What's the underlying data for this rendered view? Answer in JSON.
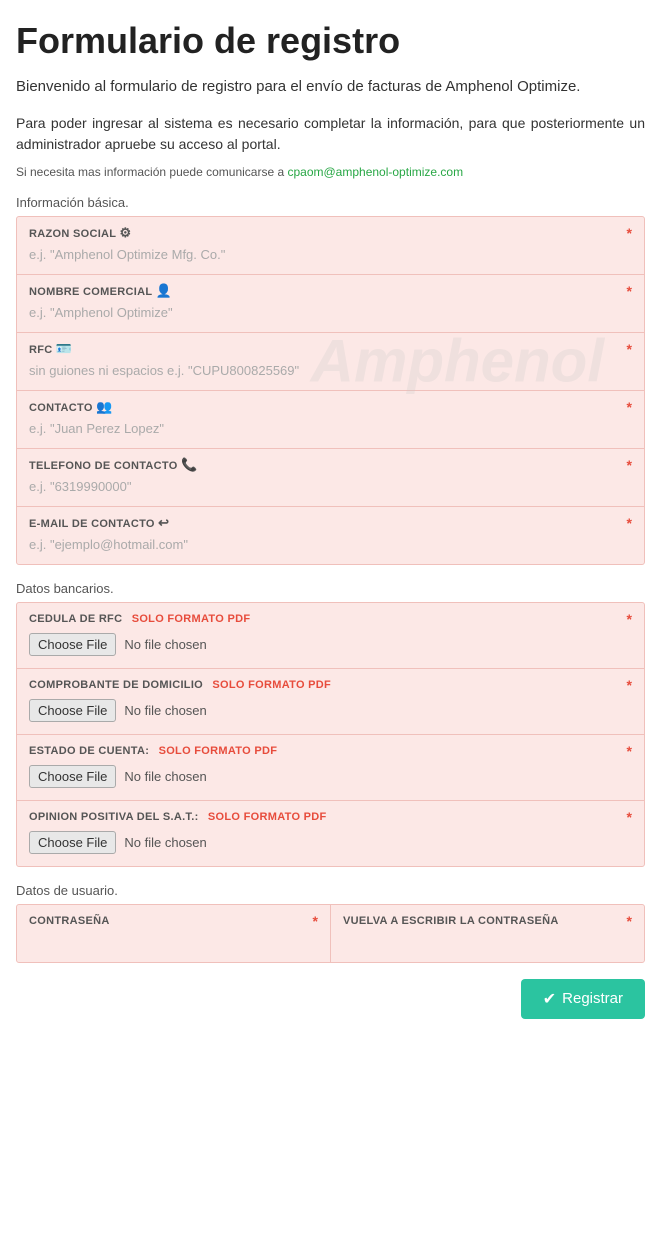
{
  "page": {
    "title": "Formulario de registro",
    "subtitle": "Bienvenido al formulario de registro para el envío de facturas de Amphenol Optimize.",
    "description": "Para poder ingresar al sistema es necesario completar la información, para que posteriormente un administrador apruebe su acceso al portal.",
    "contact_prefix": "Si necesita mas información puede comunicarse a ",
    "contact_email": "cpaom@amphenol-optimize.com",
    "section_basic_label": "Información básica.",
    "section_banking_label": "Datos bancarios.",
    "section_user_label": "Datos de usuario.",
    "watermark": "Amphenol"
  },
  "basic_fields": [
    {
      "id": "razon-social",
      "label": "RAZON SOCIAL",
      "icon": "⚙",
      "placeholder": "e.j. \"Amphenol Optimize Mfg. Co.\""
    },
    {
      "id": "nombre-comercial",
      "label": "NOMBRE COMERCIAL",
      "icon": "👤",
      "placeholder": "e.j. \"Amphenol Optimize\""
    },
    {
      "id": "rfc",
      "label": "RFC",
      "icon": "🪪",
      "placeholder": "sin guiones ni espacios e.j. \"CUPU800825569\""
    },
    {
      "id": "contacto",
      "label": "CONTACTO",
      "icon": "👥",
      "placeholder": "e.j. \"Juan Perez Lopez\""
    },
    {
      "id": "telefono",
      "label": "TELEFONO DE CONTACTO",
      "icon": "📞",
      "placeholder": "e.j. \"6319990000\""
    },
    {
      "id": "email",
      "label": "E-MAIL DE CONTACTO",
      "icon": "↩",
      "placeholder": "e.j. \"ejemplo@hotmail.com\""
    }
  ],
  "file_fields": [
    {
      "id": "cedula-rfc",
      "label": "CEDULA DE RFC",
      "pdf_label": "SOLO FORMATO PDF",
      "btn_label": "Choose File",
      "no_file_text": "No file chosen"
    },
    {
      "id": "comprobante-domicilio",
      "label": "COMPROBANTE DE DOMICILIO",
      "pdf_label": "SOLO FORMATO PDF",
      "btn_label": "Choose File",
      "no_file_text": "No file chosen"
    },
    {
      "id": "estado-cuenta",
      "label": "ESTADO DE CUENTA:",
      "pdf_label": "SOLO FORMATO PDF",
      "btn_label": "Choose File",
      "no_file_text": "No file chosen"
    },
    {
      "id": "opinion-positiva",
      "label": "OPINION POSITIVA DEL S.A.T.:",
      "pdf_label": "SOLO FORMATO PDF",
      "btn_label": "Choose File",
      "no_file_text": "No file chosen"
    }
  ],
  "password_fields": [
    {
      "id": "password",
      "label": "CONTRASEÑA",
      "placeholder": ""
    },
    {
      "id": "password-confirm",
      "label": "VUELVA A ESCRIBIR LA CONTRASEÑA",
      "placeholder": ""
    }
  ],
  "register_button": {
    "label": "Registrar",
    "checkmark": "✔"
  }
}
